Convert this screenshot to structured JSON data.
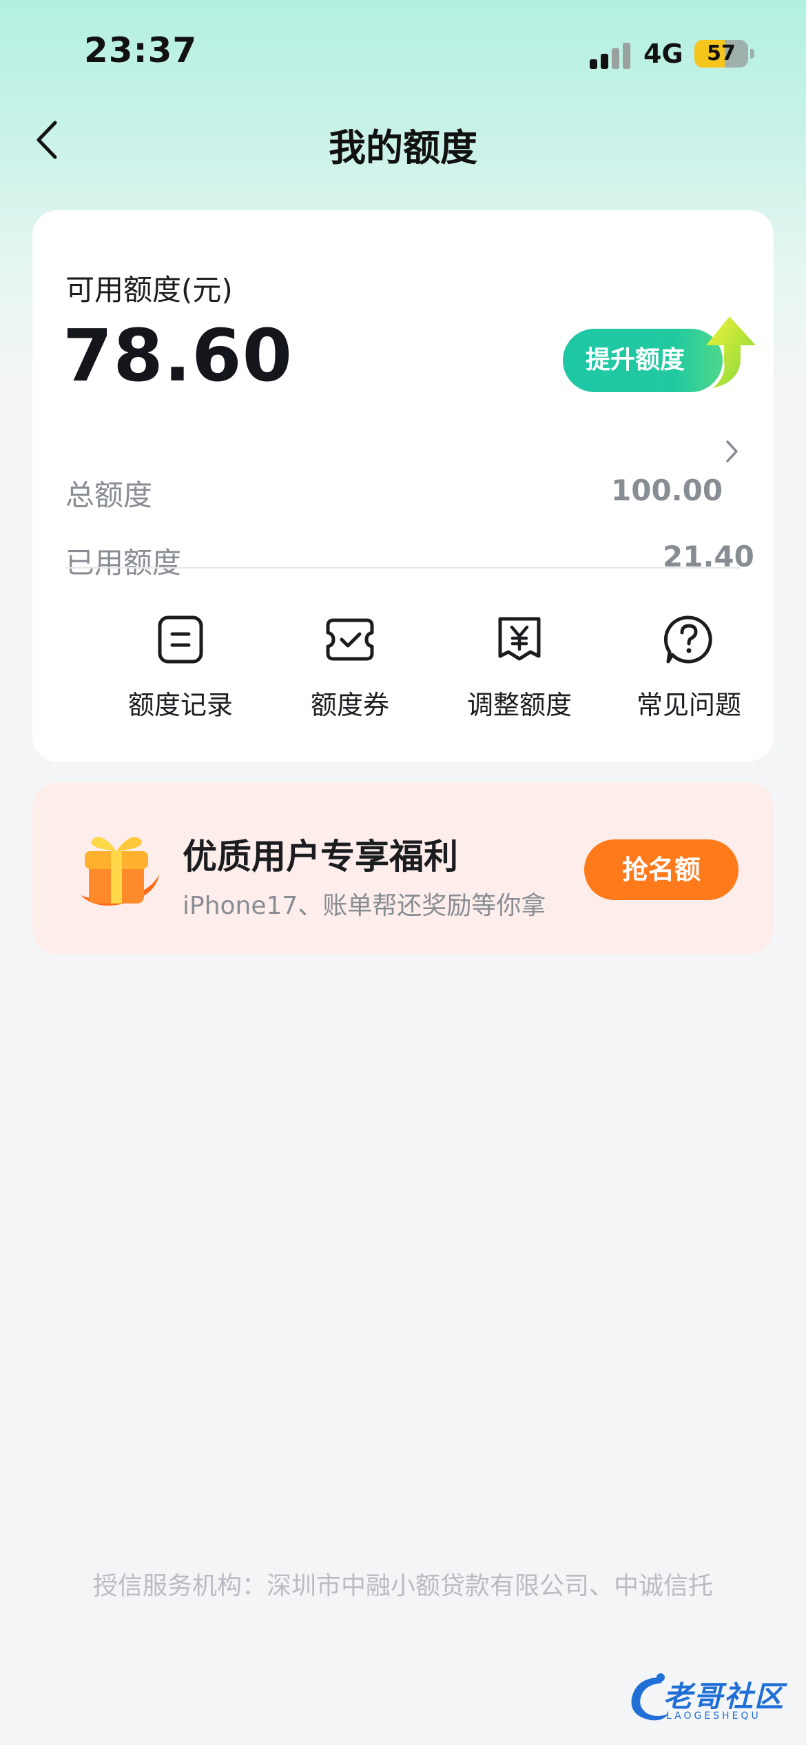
{
  "status_bar": {
    "time": "23:37",
    "network": "4G",
    "battery_level": "57"
  },
  "header": {
    "title": "我的额度",
    "back_icon": "chevron-left-icon"
  },
  "quota": {
    "available_label": "可用额度(元)",
    "available_amount": "78.60",
    "raise_button": "提升额度",
    "total_label": "总额度",
    "total_value": "100.00",
    "used_label": "已用额度",
    "used_value": "21.40"
  },
  "actions": [
    {
      "label": "额度记录",
      "icon": "record-icon"
    },
    {
      "label": "额度券",
      "icon": "coupon-icon"
    },
    {
      "label": "调整额度",
      "icon": "yuan-adjust-icon"
    },
    {
      "label": "常见问题",
      "icon": "question-icon"
    }
  ],
  "promo": {
    "title": "优质用户专享福利",
    "subtitle": "iPhone17、账单帮还奖励等你拿",
    "button": "抢名额",
    "icon": "gift-icon"
  },
  "footer": {
    "text": "授信服务机构：深圳市中融小额贷款有限公司、中诚信托"
  },
  "watermark": {
    "text": "老哥社区",
    "sub": "LAOGESHEQU"
  },
  "colors": {
    "accent": "#1ec7a5",
    "promo_button": "#ff7a1a",
    "promo_bg": "#fdeeeb"
  }
}
